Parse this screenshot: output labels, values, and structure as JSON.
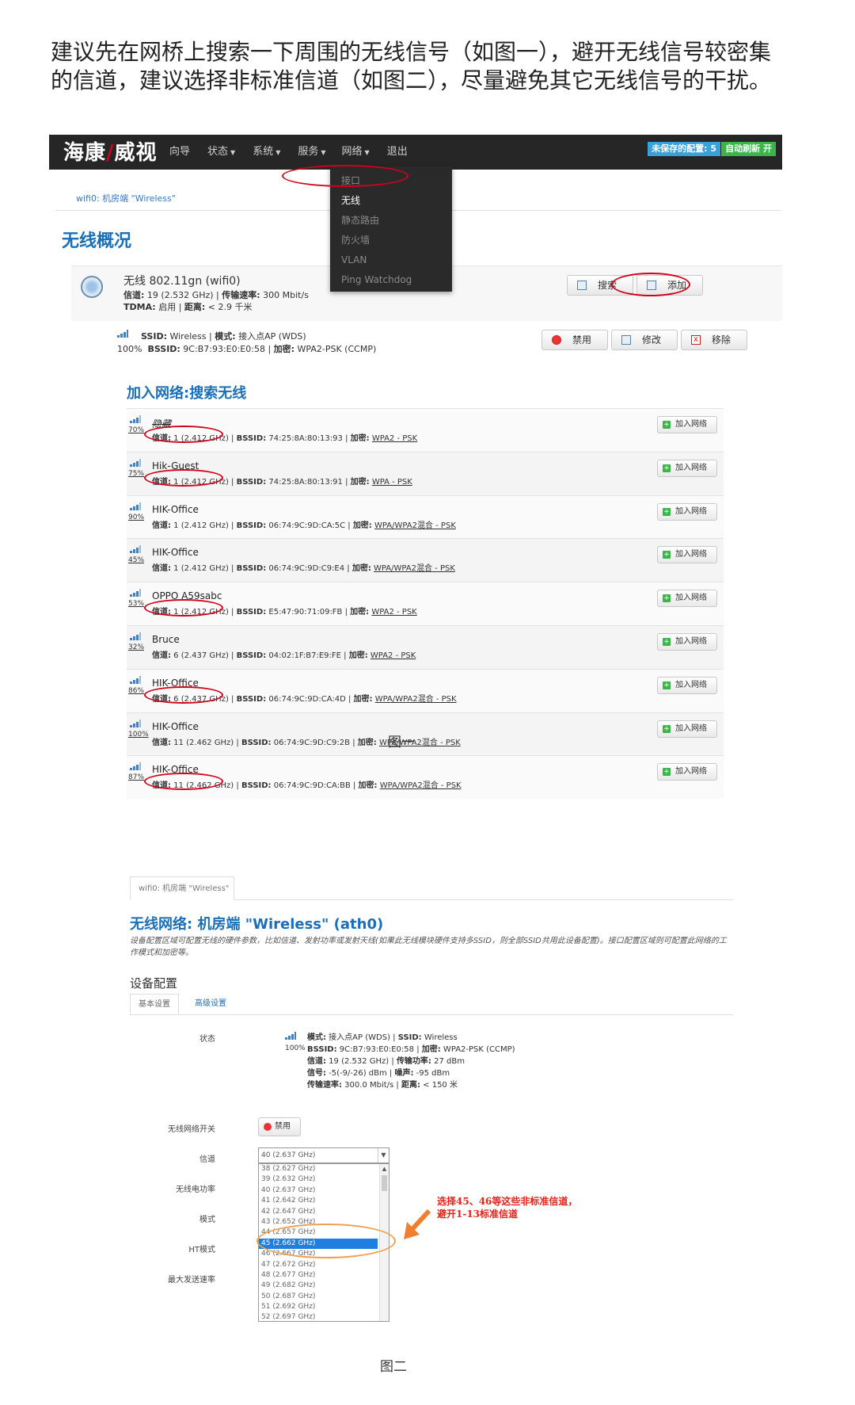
{
  "intro": "建议先在网桥上搜索一下周围的无线信号（如图一），避开无线信号较密集的信道，建议选择非标准信道（如图二），尽量避免其它无线信号的干扰。",
  "figure1": {
    "logo": {
      "part1": "海康",
      "part2": "威视"
    },
    "menu": [
      {
        "label": "向导",
        "caret": false
      },
      {
        "label": "状态",
        "caret": true
      },
      {
        "label": "系统",
        "caret": true
      },
      {
        "label": "服务",
        "caret": true
      },
      {
        "label": "网络",
        "caret": true
      },
      {
        "label": "退出",
        "caret": false
      }
    ],
    "unsaved_badge": "未保存的配置: 5",
    "refresh_badge": "自动刷新 开",
    "breadcrumb": "wifi0: 机房端 \"Wireless\"",
    "dropdown": [
      "接口",
      "无线",
      "静态路由",
      "防火墙",
      "VLAN",
      "Ping Watchdog"
    ],
    "overview_title": "无线概况",
    "radio": {
      "name": "无线 802.11gn (wifi0)",
      "line1_k1": "信道:",
      "line1_v1": " 19 (2.532 GHz) | ",
      "line1_k2": "传输速率:",
      "line1_v2": " 300 Mbit/s",
      "line2_k1": "TDMA:",
      "line2_v1": " 启用 | ",
      "line2_k2": "距离:",
      "line2_v2": " < 2.9 千米"
    },
    "buttons": {
      "search": "搜索",
      "add": "添加",
      "disable": "禁用",
      "edit": "修改",
      "remove": "移除"
    },
    "ssid_row": {
      "line1_k1": "SSID:",
      "line1_v1": " Wireless | ",
      "line1_k2": "模式:",
      "line1_v2": " 接入点AP (WDS)",
      "pct": "100%",
      "line2_k1": "BSSID:",
      "line2_v1": " 9C:B7:93:E0:E0:58 | ",
      "line2_k2": "加密:",
      "line2_v2": " WPA2-PSK (CCMP)"
    },
    "join_title": "加入网络:搜索无线",
    "join_label": "加入网络",
    "scan_results": [
      {
        "ssid": "隐藏",
        "pct": "70%",
        "channel": " 1 (2.412 GHz)",
        "bssid": " 74:25:8A:80:13:93",
        "enc": "WPA2 - PSK"
      },
      {
        "ssid": "Hik-Guest",
        "pct": "75%",
        "channel": " 1 (2.412 GHz)",
        "bssid": " 74:25:8A:80:13:91",
        "enc": "WPA - PSK"
      },
      {
        "ssid": "HIK-Office",
        "pct": "90%",
        "channel": " 1 (2.412 GHz)",
        "bssid": " 06:74:9C:9D:CA:5C",
        "enc": "WPA/WPA2混合 - PSK"
      },
      {
        "ssid": "HIK-Office",
        "pct": "45%",
        "channel": " 1 (2.412 GHz)",
        "bssid": " 06:74:9C:9D:C9:E4",
        "enc": "WPA/WPA2混合 - PSK"
      },
      {
        "ssid": "OPPO A59sabc",
        "pct": "53%",
        "channel": " 1 (2.412 GHz)",
        "bssid": " E5:47:90:71:09:FB",
        "enc": "WPA2 - PSK"
      },
      {
        "ssid": "Bruce",
        "pct": "32%",
        "channel": " 6 (2.437 GHz)",
        "bssid": " 04:02:1F:B7:E9:FE",
        "enc": "WPA2 - PSK"
      },
      {
        "ssid": "HIK-Office",
        "pct": "86%",
        "channel": " 6 (2.437 GHz)",
        "bssid": " 06:74:9C:9D:CA:4D",
        "enc": "WPA/WPA2混合 - PSK"
      },
      {
        "ssid": "HIK-Office",
        "pct": "100%",
        "channel": " 11 (2.462 GHz)",
        "bssid": " 06:74:9C:9D:C9:2B",
        "enc": "WPA/WPA2混合 - PSK"
      },
      {
        "ssid": "HIK-Office",
        "pct": "87%",
        "channel": " 11 (2.462 GHz)",
        "bssid": " 06:74:9C:9D:CA:BB",
        "enc": "WPA/WPA2混合 - PSK"
      }
    ],
    "row_labels": {
      "channel": "信道:",
      "bssid": "BSSID:",
      "enc": "加密:"
    },
    "caption": "图一"
  },
  "figure2": {
    "tab": "wifi0: 机房端 \"Wireless\"",
    "title": "无线网络: 机房端 \"Wireless\" (ath0)",
    "desc": "设备配置区域可配置无线的硬件参数，比如信道、发射功率或发射天线(如果此无线模块硬件支持多SSID，则全部SSID共用此设备配置)。接口配置区域则可配置此网络的工作模式和加密等。",
    "device_config": "设备配置",
    "subtabs": {
      "basic": "基本设置",
      "advanced": "高级设置"
    },
    "labels": {
      "status": "状态",
      "switch": "无线网络开关",
      "channel": "信道",
      "power": "无线电功率",
      "mode": "模式",
      "ht": "HT模式",
      "rate": "最大发送速率"
    },
    "status": {
      "pct": "100%",
      "l1k1": "模式:",
      "l1v1": " 接入点AP (WDS) | ",
      "l1k2": "SSID:",
      "l1v2": " Wireless",
      "l2k1": "BSSID:",
      "l2v1": " 9C:B7:93:E0:E0:58 | ",
      "l2k2": "加密:",
      "l2v2": " WPA2-PSK (CCMP)",
      "l3k1": "信道:",
      "l3v1": " 19 (2.532 GHz) | ",
      "l3k2": "传输功率:",
      "l3v2": " 27 dBm",
      "l4k1": "信号:",
      "l4v1": " -5(-9/-26) dBm | ",
      "l4k2": "噪声:",
      "l4v2": " -95 dBm",
      "l5k1": "传输速率:",
      "l5v1": " 300.0 Mbit/s | ",
      "l5k2": "距离:",
      "l5v2": " < 150 米"
    },
    "disable_btn": "禁用",
    "channel_selected": "40 (2.637 GHz)",
    "channel_options": [
      "38 (2.627 GHz)",
      "39 (2.632 GHz)",
      "40 (2.637 GHz)",
      "41 (2.642 GHz)",
      "42 (2.647 GHz)",
      "43 (2.652 GHz)",
      "44 (2.657 GHz)",
      "45 (2.662 GHz)",
      "46 (2.667 GHz)",
      "47 (2.672 GHz)",
      "48 (2.677 GHz)",
      "49 (2.682 GHz)",
      "50 (2.687 GHz)",
      "51 (2.692 GHz)",
      "52 (2.697 GHz)"
    ],
    "highlighted_option": "45 (2.662 GHz)",
    "note_line1": "选择45、46等这些非标准信道，",
    "note_line2": "避开1-13标准信道",
    "caption": "图二"
  },
  "colors": {
    "accent": "#1a6fb8",
    "annotation_red": "#d0021b",
    "annotation_orange": "#f0a050",
    "nav_bg": "#262626"
  }
}
